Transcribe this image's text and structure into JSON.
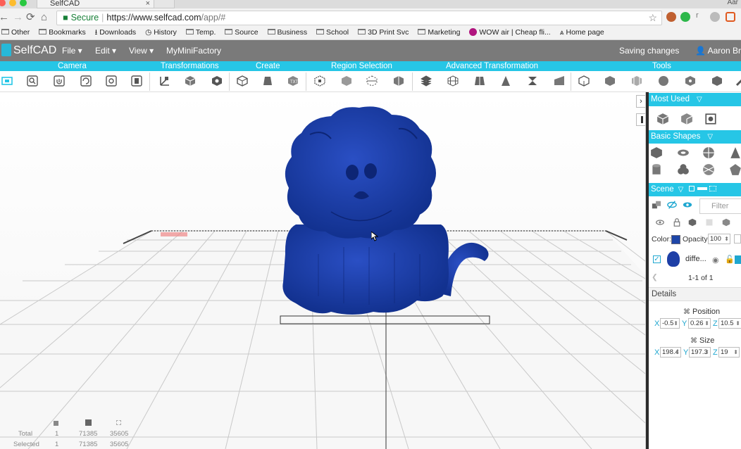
{
  "browser": {
    "tab_title": "SelfCAD",
    "tab_close": "×",
    "corner_user": "Aar",
    "nav": {
      "back": "←",
      "forward": "→",
      "reload": "⟳",
      "home": "⌂"
    },
    "url": {
      "lock": "🔒",
      "secure": "Secure",
      "separator": "|",
      "host": "https://www.selfcad.com",
      "path": "/app/#",
      "star": "☆"
    },
    "extensions": [
      {
        "name": "profile-extension-icon",
        "color": "#c06030"
      },
      {
        "name": "green-extension-icon",
        "color": "#2db74a"
      },
      {
        "name": "r-extension-icon",
        "color": "#f2f2f2"
      },
      {
        "name": "grey-extension-icon",
        "color": "#bbbbbb"
      },
      {
        "name": "orange-extension-icon",
        "color": "#e05a20"
      }
    ],
    "ext_r_label": "r",
    "bookmarks": {
      "other": "Other",
      "bookmarks": "Bookmarks",
      "downloads": "Downloads",
      "history": "History",
      "temp": "Temp.",
      "source": "Source",
      "business": "Business",
      "school": "School",
      "print": "3D Print Svc",
      "marketing": "Marketing",
      "wow": "WOW air | Cheap fli...",
      "home": "Home page"
    }
  },
  "app": {
    "logo": "SelfCAD",
    "menus": {
      "file": "File ▾",
      "edit": "Edit ▾",
      "view": "View ▾",
      "mmf": "MyMiniFactory"
    },
    "status": "Saving changes",
    "user": "Aaron Bre"
  },
  "categories": {
    "camera": "Camera",
    "transformations": "Transformations",
    "create": "Create",
    "region": "Region Selection",
    "advanced": "Advanced Transformation",
    "tools": "Tools"
  },
  "stats": {
    "total_label": "Total",
    "selected_label": "Selected",
    "total": {
      "objects": "1",
      "faces": "71385",
      "vertices": "35605"
    },
    "selected": {
      "objects": "1",
      "faces": "71385",
      "vertices": "35605"
    }
  },
  "panel": {
    "collapse": "›",
    "most_used": "Most Used",
    "basic_shapes": "Basic Shapes",
    "scene": "Scene",
    "section_arrow": "▽",
    "filter_placeholder": "Filter",
    "color_label": "Color:",
    "opacity_label": "Opacity:",
    "opacity_value": "100",
    "object_name": "diffe...",
    "pagination": "1-1 of 1",
    "details": "Details",
    "position_label": "Position",
    "size_label": "Size",
    "axes": {
      "x": "X",
      "y": "Y",
      "z": "Z"
    },
    "position": {
      "x": "-0.5",
      "y": "0.26",
      "z": "10.5"
    },
    "size": {
      "x": "198.4",
      "y": "197.3",
      "z": "19"
    }
  },
  "colors": {
    "accent": "#26c6e6",
    "model": "#1e3fa6",
    "header": "#7a7a7a"
  }
}
